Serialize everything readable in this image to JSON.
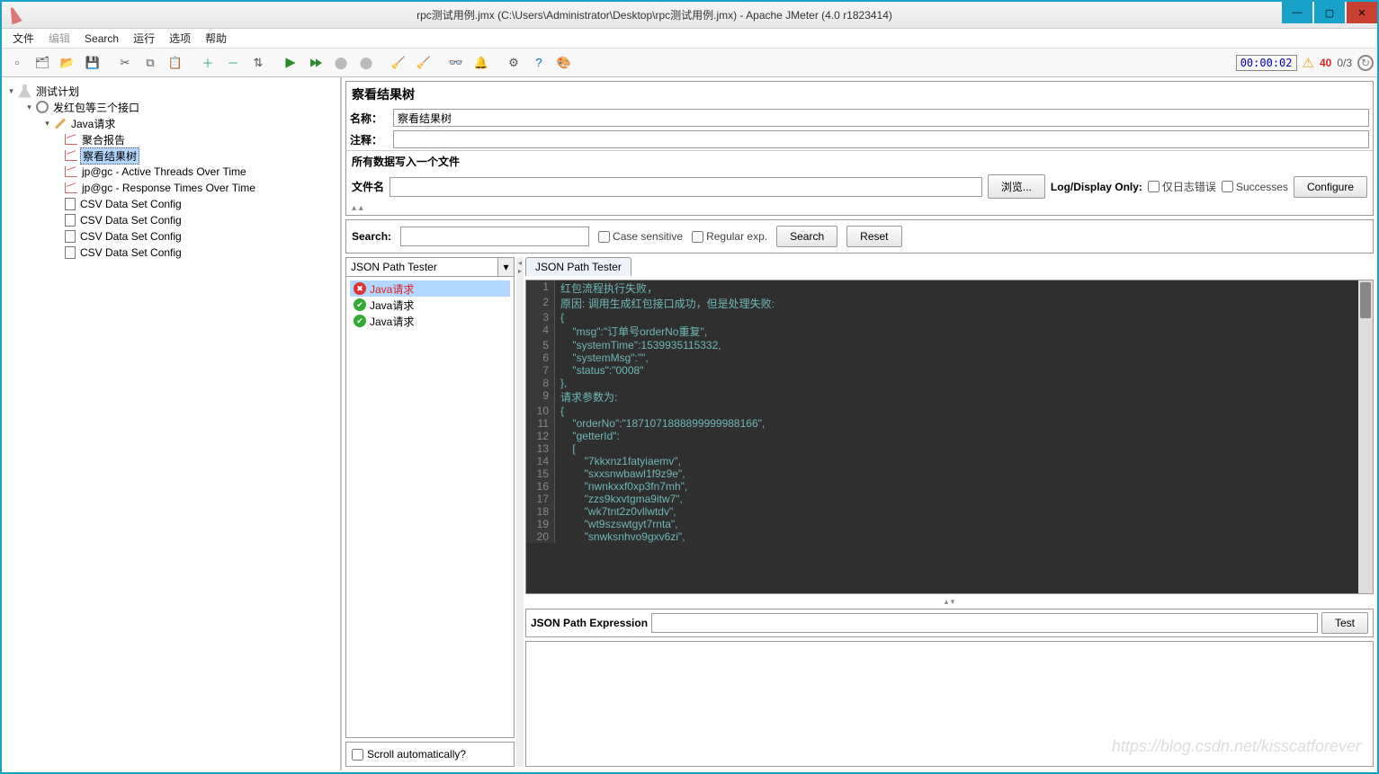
{
  "window": {
    "title": "rpc测试用例.jmx (C:\\Users\\Administrator\\Desktop\\rpc测试用例.jmx) - Apache JMeter (4.0 r1823414)"
  },
  "menu": {
    "file": "文件",
    "edit": "编辑",
    "search": "Search",
    "run": "运行",
    "options": "选项",
    "help": "帮助"
  },
  "status": {
    "timer": "00:00:02",
    "errors": "40",
    "threads": "0/3"
  },
  "tree": {
    "root": "测试计划",
    "tg": "发红包等三个接口",
    "sampler": "Java请求",
    "agg": "聚合报告",
    "view": "察看结果树",
    "jp1": "jp@gc - Active Threads Over Time",
    "jp2": "jp@gc - Response Times Over Time",
    "csv1": "CSV Data Set Config",
    "csv2": "CSV Data Set Config",
    "csv3": "CSV Data Set Config",
    "csv4": "CSV Data Set Config"
  },
  "header": {
    "title": "察看结果树",
    "name_label": "名称：",
    "name_value": "察看结果树",
    "comment_label": "注释："
  },
  "filewrite": {
    "section": "所有数据写入一个文件",
    "filename_label": "文件名",
    "browse": "浏览...",
    "logonly": "Log/Display Only:",
    "errorsonly": "仅日志错误",
    "successes": "Successes",
    "configure": "Configure"
  },
  "search": {
    "label": "Search:",
    "case": "Case sensitive",
    "regex": "Regular exp.",
    "search_btn": "Search",
    "reset_btn": "Reset"
  },
  "results": {
    "renderer": "JSON Path Tester",
    "tab": "JSON Path Tester",
    "samples": [
      {
        "name": "Java请求",
        "status": "err"
      },
      {
        "name": "Java请求",
        "status": "ok"
      },
      {
        "name": "Java请求",
        "status": "ok"
      }
    ],
    "scroll_auto": "Scroll automatically?",
    "jpath_label": "JSON Path Expression",
    "test_btn": "Test"
  },
  "code": [
    "红包流程执行失败，",
    "原因: 调用生成红包接口成功，但是处理失败:",
    "{",
    "    \"msg\":\"订单号orderNo重复\",",
    "    \"systemTime\":1539935115332,",
    "    \"systemMsg\":\"\",",
    "    \"status\":\"0008\"",
    "},",
    "请求参数为:",
    "{",
    "    \"orderNo\":\"1871071888899999988166\",",
    "    \"getterId\":",
    "    [",
    "        \"7kkxnz1fatyiaemv\",",
    "        \"sxxsnwbawl1f9z9e\",",
    "        \"nwnkxxf0xp3fn7mh\",",
    "        \"zzs9kxvtgma9itw7\",",
    "        \"wk7tnt2z0vllwtdv\",",
    "        \"wt9szswtgyt7rnta\",",
    "        \"snwksnhvo9gxv6zi\","
  ],
  "watermark": "https://blog.csdn.net/kisscatforever"
}
